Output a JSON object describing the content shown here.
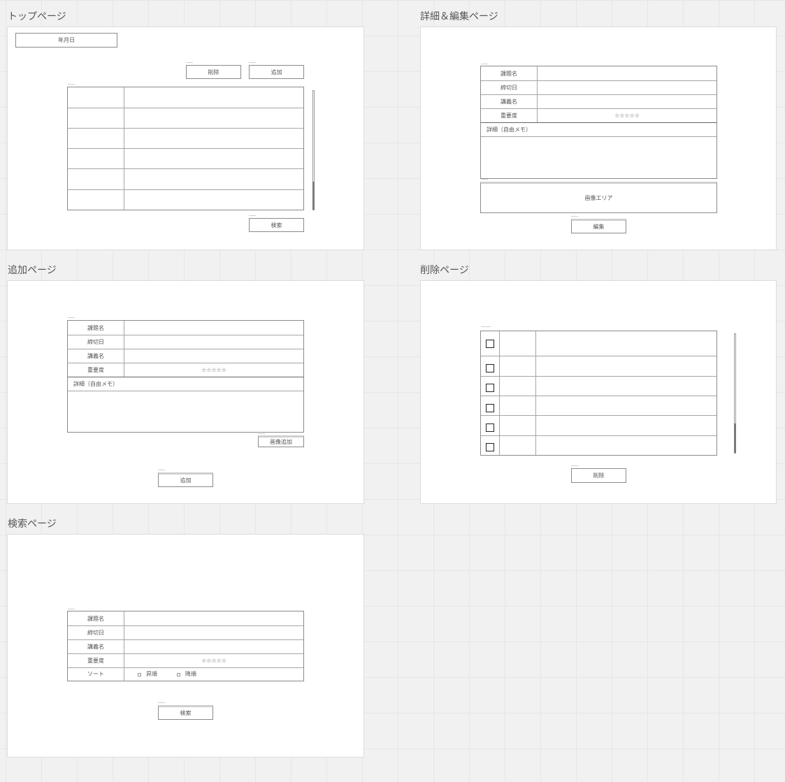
{
  "pages": {
    "top": {
      "title": "トップページ",
      "date_field": "年月日",
      "delete_button": "削除",
      "add_button": "追加",
      "search_button": "検索"
    },
    "detail": {
      "title": "詳細＆編集ページ",
      "fields": [
        "課題名",
        "締切日",
        "講義名",
        "重要度"
      ],
      "stars": "☆☆☆☆☆",
      "memo_label": "詳細（自由メモ）",
      "image_area": "画像エリア",
      "edit_button": "編集"
    },
    "add": {
      "title": "追加ページ",
      "fields": [
        "課題名",
        "締切日",
        "講義名",
        "重要度"
      ],
      "stars": "☆☆☆☆☆",
      "memo_label": "詳細（自由メモ）",
      "add_image_button": "画像追加",
      "add_button": "追加"
    },
    "delete": {
      "title": "削除ページ",
      "delete_button": "削除"
    },
    "search": {
      "title": "検索ページ",
      "fields": [
        "課題名",
        "締切日",
        "講義名",
        "重要度",
        "ソート"
      ],
      "stars": "☆☆☆☆☆",
      "sort_options": [
        "昇順",
        "降順"
      ],
      "search_button": "検索"
    }
  }
}
